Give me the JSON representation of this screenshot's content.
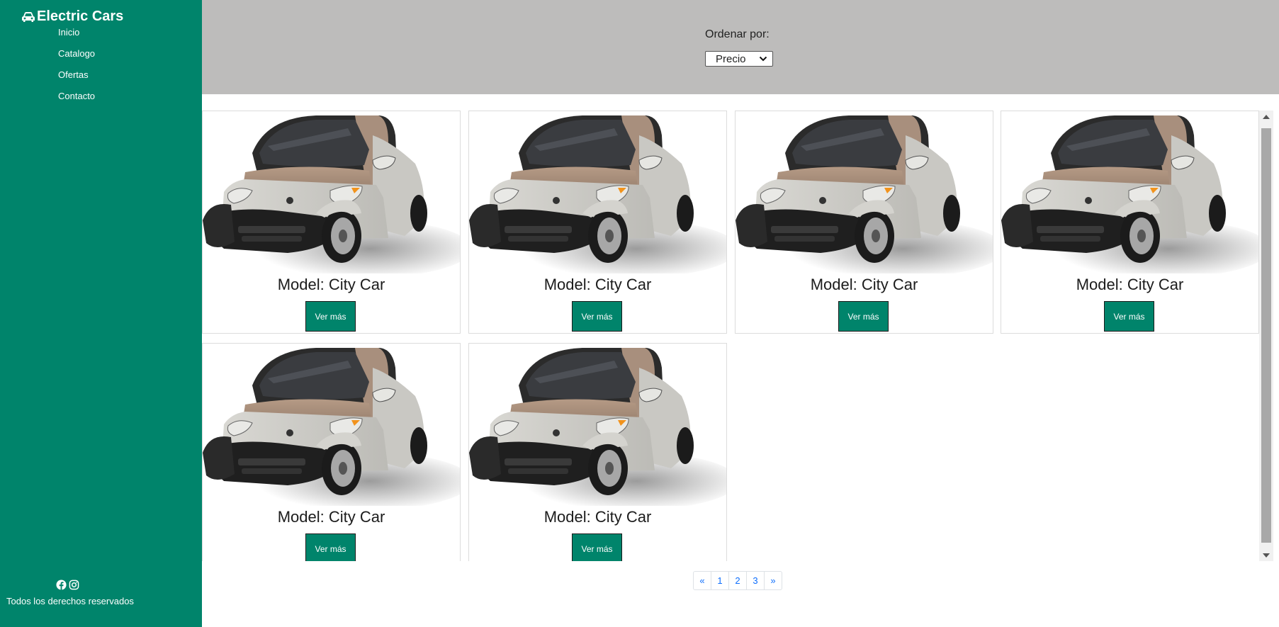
{
  "sidebar": {
    "brand": "Electric Cars",
    "nav": [
      {
        "label": "Inicio"
      },
      {
        "label": "Catalogo"
      },
      {
        "label": "Ofertas"
      },
      {
        "label": "Contacto"
      }
    ],
    "social_icons": [
      "facebook-icon",
      "instagram-icon"
    ],
    "footer_text": "Todos los derechos reservados"
  },
  "filter": {
    "label": "Ordenar por:",
    "selected": "Precio"
  },
  "cards": [
    {
      "model": "Model: City Car",
      "button": "Ver más"
    },
    {
      "model": "Model: City Car",
      "button": "Ver más"
    },
    {
      "model": "Model: City Car",
      "button": "Ver más"
    },
    {
      "model": "Model: City Car",
      "button": "Ver más"
    },
    {
      "model": "Model: City Car",
      "button": "Ver más"
    },
    {
      "model": "Model: City Car",
      "button": "Ver más"
    }
  ],
  "pagination": [
    "«",
    "1",
    "2",
    "3",
    "»"
  ],
  "colors": {
    "brand_green": "#00846b",
    "filter_bg": "#bdbcbb",
    "link_blue": "#0d6efd"
  }
}
